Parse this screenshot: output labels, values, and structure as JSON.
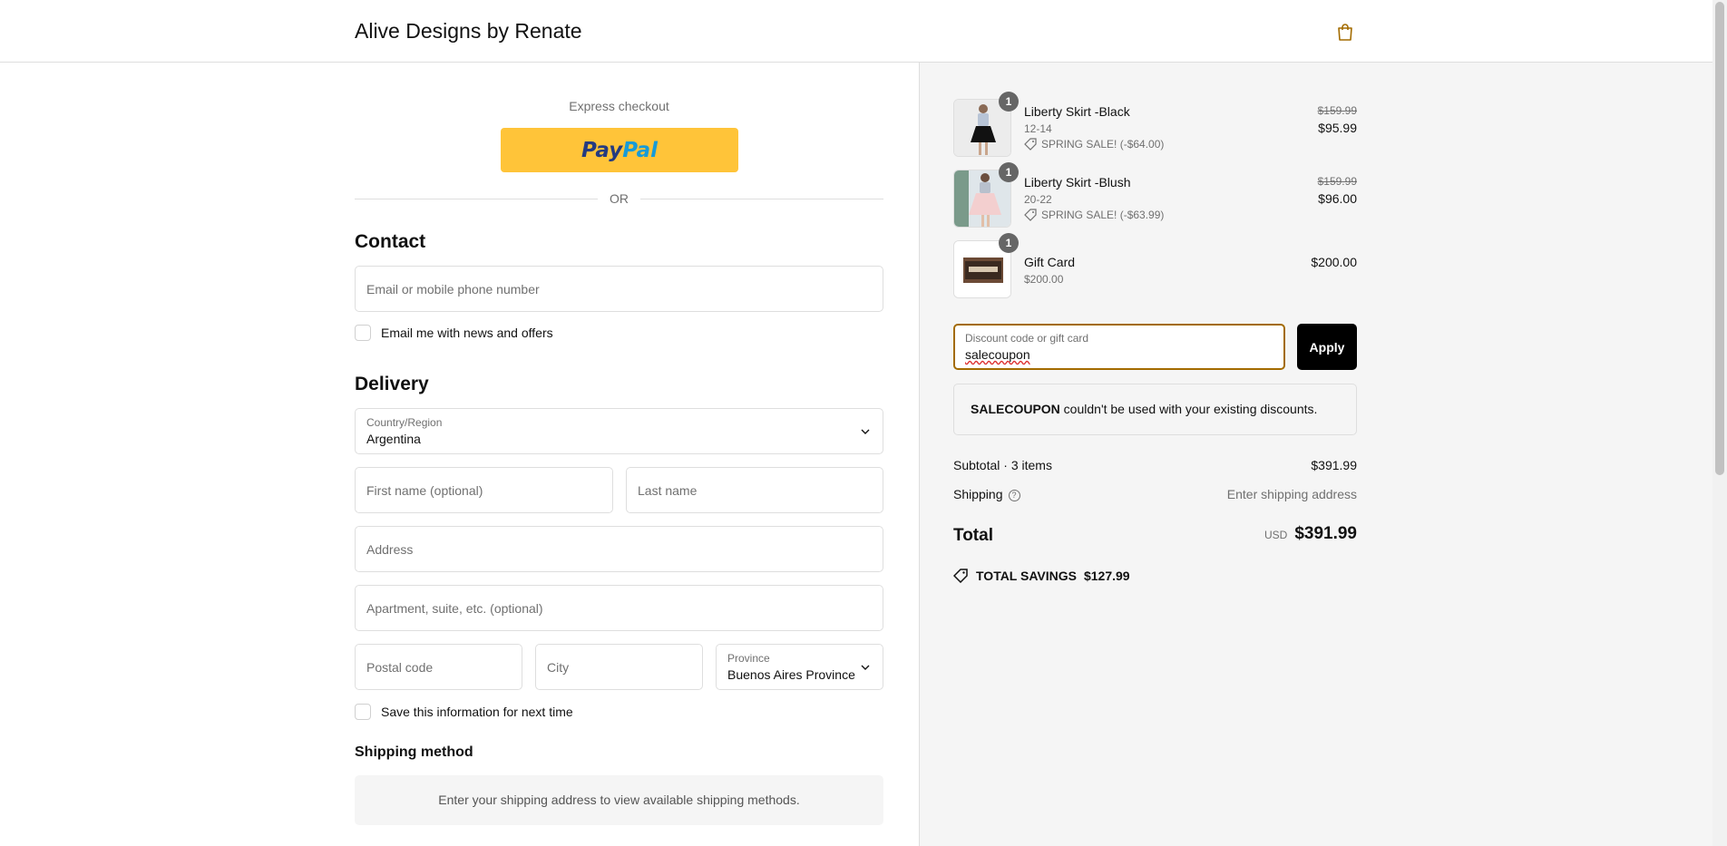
{
  "header": {
    "store_name": "Alive Designs by Renate",
    "cart_icon": "shopping-bag-icon"
  },
  "express": {
    "title": "Express checkout",
    "paypal_part1": "Pay",
    "paypal_part2": "Pal",
    "or_text": "OR"
  },
  "contact": {
    "title": "Contact",
    "email_placeholder": "Email or mobile phone number",
    "news_checkbox_label": "Email me with news and offers"
  },
  "delivery": {
    "title": "Delivery",
    "country_label": "Country/Region",
    "country_value": "Argentina",
    "first_name_placeholder": "First name (optional)",
    "last_name_placeholder": "Last name",
    "address_placeholder": "Address",
    "apartment_placeholder": "Apartment, suite, etc. (optional)",
    "postal_placeholder": "Postal code",
    "city_placeholder": "City",
    "province_label": "Province",
    "province_value": "Buenos Aires Province",
    "save_info_label": "Save this information for next time"
  },
  "shipping_method": {
    "title": "Shipping method",
    "message": "Enter your shipping address to view available shipping methods."
  },
  "order": {
    "items": [
      {
        "qty": "1",
        "name": "Liberty Skirt -Black",
        "variant": "12-14",
        "discount": "SPRING SALE! (-$64.00)",
        "price_old": "$159.99",
        "price": "$95.99"
      },
      {
        "qty": "1",
        "name": "Liberty Skirt -Blush",
        "variant": "20-22",
        "discount": "SPRING SALE! (-$63.99)",
        "price_old": "$159.99",
        "price": "$96.00"
      },
      {
        "qty": "1",
        "name": "Gift Card",
        "variant": "$200.00",
        "price": "$200.00"
      }
    ],
    "discount_label": "Discount code or gift card",
    "discount_value": "salecoupon",
    "apply_label": "Apply",
    "error_code": "SALECOUPON",
    "error_text": " couldn't be used with your existing discounts.",
    "subtotal_label": "Subtotal · 3 items",
    "subtotal_value": "$391.99",
    "shipping_label": "Shipping",
    "shipping_value": "Enter shipping address",
    "total_label": "Total",
    "total_currency": "USD",
    "total_value": "$391.99",
    "savings_label": "TOTAL SAVINGS",
    "savings_value": "$127.99"
  },
  "colors": {
    "paypal_yellow": "#ffc439",
    "focus_border": "#a36b00",
    "apply_button": "#000000",
    "summary_bg": "#f5f5f5"
  }
}
